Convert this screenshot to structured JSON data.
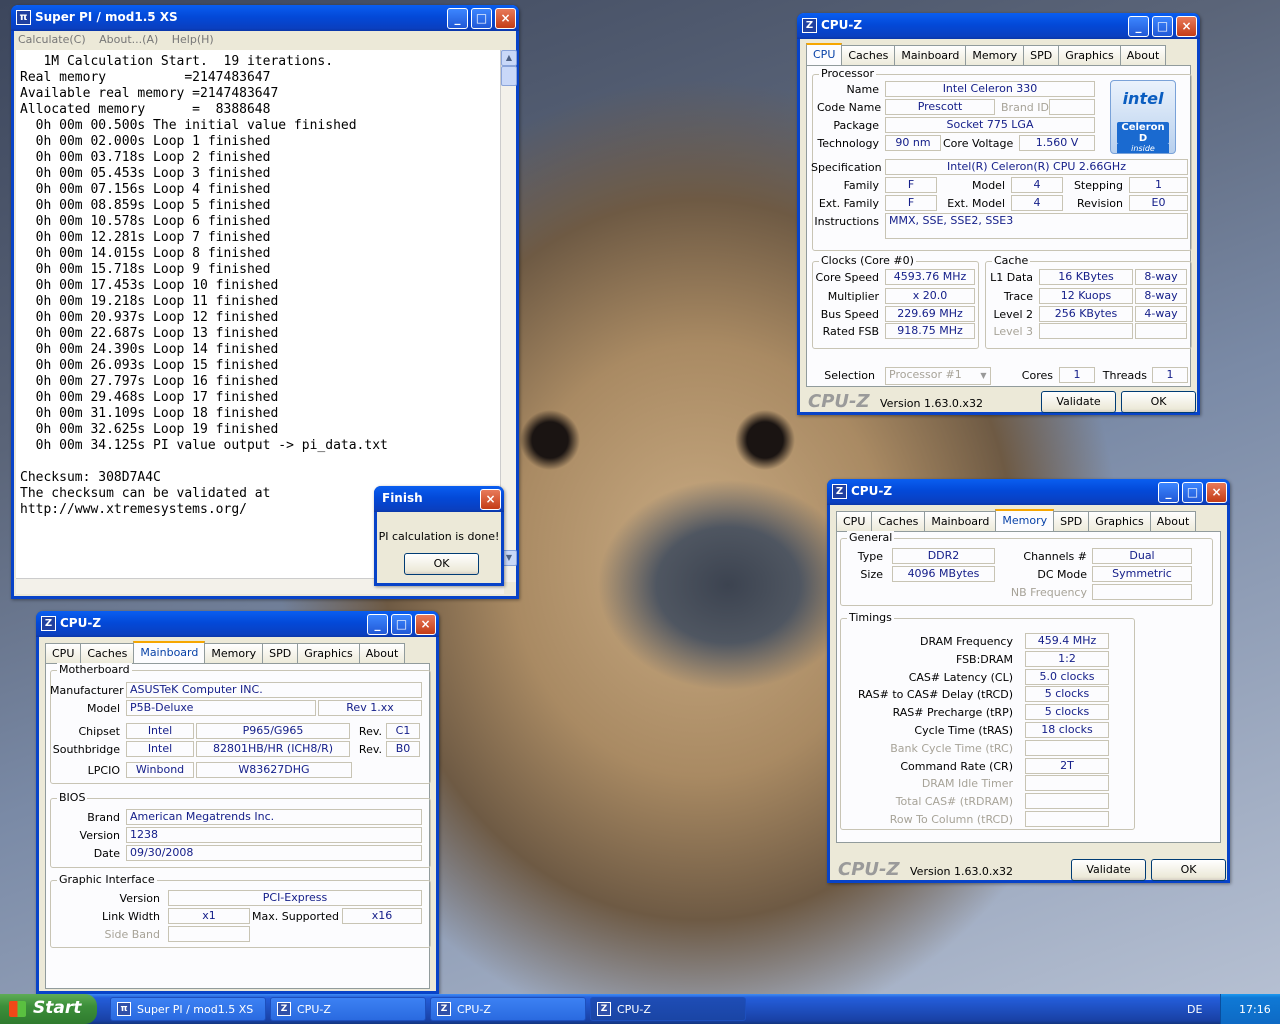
{
  "superpi": {
    "title": "Super PI / mod1.5 XS",
    "menu": [
      "Calculate(C)",
      "About...(A)",
      "Help(H)"
    ],
    "output": "   1M Calculation Start.  19 iterations.\nReal memory          =2147483647\nAvailable real memory =2147483647\nAllocated memory      =  8388648\n  0h 00m 00.500s The initial value finished\n  0h 00m 02.000s Loop 1 finished\n  0h 00m 03.718s Loop 2 finished\n  0h 00m 05.453s Loop 3 finished\n  0h 00m 07.156s Loop 4 finished\n  0h 00m 08.859s Loop 5 finished\n  0h 00m 10.578s Loop 6 finished\n  0h 00m 12.281s Loop 7 finished\n  0h 00m 14.015s Loop 8 finished\n  0h 00m 15.718s Loop 9 finished\n  0h 00m 17.453s Loop 10 finished\n  0h 00m 19.218s Loop 11 finished\n  0h 00m 20.937s Loop 12 finished\n  0h 00m 22.687s Loop 13 finished\n  0h 00m 24.390s Loop 14 finished\n  0h 00m 26.093s Loop 15 finished\n  0h 00m 27.797s Loop 16 finished\n  0h 00m 29.468s Loop 17 finished\n  0h 00m 31.109s Loop 18 finished\n  0h 00m 32.625s Loop 19 finished\n  0h 00m 34.125s PI value output -> pi_data.txt\n\nChecksum: 308D7A4C\nThe checksum can be validated at\nhttp://www.xtremesystems.org/"
  },
  "finish": {
    "title": "Finish",
    "message": "PI calculation is done!",
    "ok": "OK"
  },
  "cpuz_title": "CPU-Z",
  "cpuz_tabs": [
    "CPU",
    "Caches",
    "Mainboard",
    "Memory",
    "SPD",
    "Graphics",
    "About"
  ],
  "cpuz_brand": "CPU-Z",
  "cpuz_version": "Version 1.63.0.x32",
  "validate": "Validate",
  "ok": "OK",
  "cpu": {
    "processor_group": "Processor",
    "name_label": "Name",
    "name": "Intel Celeron 330",
    "codename_label": "Code Name",
    "codename": "Prescott",
    "brandid_label": "Brand ID",
    "brandid": "",
    "package_label": "Package",
    "package": "Socket 775 LGA",
    "technology_label": "Technology",
    "technology": "90 nm",
    "corevoltage_label": "Core Voltage",
    "corevoltage": "1.560 V",
    "spec_label": "Specification",
    "spec": "Intel(R) Celeron(R) CPU 2.66GHz",
    "family_label": "Family",
    "family": "F",
    "model_label": "Model",
    "model": "4",
    "stepping_label": "Stepping",
    "stepping": "1",
    "extfamily_label": "Ext. Family",
    "extfamily": "F",
    "extmodel_label": "Ext. Model",
    "extmodel": "4",
    "revision_label": "Revision",
    "revision": "E0",
    "instructions_label": "Instructions",
    "instructions": "MMX, SSE, SSE2, SSE3",
    "logo_top": "intel",
    "logo_bottom": "Celeron D",
    "logo_inside": "inside",
    "clocks_group": "Clocks (Core #0)",
    "corespeed_label": "Core Speed",
    "corespeed": "4593.76 MHz",
    "multiplier_label": "Multiplier",
    "multiplier": "x 20.0",
    "busspeed_label": "Bus Speed",
    "busspeed": "229.69 MHz",
    "ratedfsb_label": "Rated FSB",
    "ratedfsb": "918.75 MHz",
    "cache_group": "Cache",
    "l1data_label": "L1 Data",
    "l1data": "16 KBytes",
    "l1data_way": "8-way",
    "trace_label": "Trace",
    "trace": "12 Kuops",
    "trace_way": "8-way",
    "level2_label": "Level 2",
    "level2": "256 KBytes",
    "level2_way": "4-way",
    "level3_label": "Level 3",
    "selection_label": "Selection",
    "selection": "Processor #1",
    "cores_label": "Cores",
    "cores": "1",
    "threads_label": "Threads",
    "threads": "1"
  },
  "mainboard": {
    "motherboard_group": "Motherboard",
    "manufacturer_label": "Manufacturer",
    "manufacturer": "ASUSTeK Computer INC.",
    "model_label": "Model",
    "model": "P5B-Deluxe",
    "model_rev": "Rev 1.xx",
    "chipset_label": "Chipset",
    "chipset_vendor": "Intel",
    "chipset": "P965/G965",
    "rev_label": "Rev.",
    "chipset_rev": "C1",
    "southbridge_label": "Southbridge",
    "sb_vendor": "Intel",
    "southbridge": "82801HB/HR (ICH8/R)",
    "sb_rev": "B0",
    "lpcio_label": "LPCIO",
    "lpcio_vendor": "Winbond",
    "lpcio": "W83627DHG",
    "bios_group": "BIOS",
    "brand_label": "Brand",
    "brand": "American Megatrends Inc.",
    "version_label": "Version",
    "version": "1238",
    "date_label": "Date",
    "date": "09/30/2008",
    "graphic_group": "Graphic Interface",
    "gi_version_label": "Version",
    "gi_version": "PCI-Express",
    "linkwidth_label": "Link Width",
    "linkwidth": "x1",
    "maxsupported_label": "Max. Supported",
    "maxsupported": "x16",
    "sideband_label": "Side Band"
  },
  "memory": {
    "general_group": "General",
    "type_label": "Type",
    "type": "DDR2",
    "channels_label": "Channels #",
    "channels": "Dual",
    "size_label": "Size",
    "size": "4096 MBytes",
    "dcmode_label": "DC Mode",
    "dcmode": "Symmetric",
    "nbfreq_label": "NB Frequency",
    "timings_group": "Timings",
    "rows": [
      {
        "label": "DRAM Frequency",
        "value": "459.4 MHz",
        "enabled": true
      },
      {
        "label": "FSB:DRAM",
        "value": "1:2",
        "enabled": true
      },
      {
        "label": "CAS# Latency (CL)",
        "value": "5.0 clocks",
        "enabled": true
      },
      {
        "label": "RAS# to CAS# Delay (tRCD)",
        "value": "5 clocks",
        "enabled": true
      },
      {
        "label": "RAS# Precharge (tRP)",
        "value": "5 clocks",
        "enabled": true
      },
      {
        "label": "Cycle Time (tRAS)",
        "value": "18 clocks",
        "enabled": true
      },
      {
        "label": "Bank Cycle Time (tRC)",
        "value": "",
        "enabled": false
      },
      {
        "label": "Command Rate (CR)",
        "value": "2T",
        "enabled": true
      },
      {
        "label": "DRAM Idle Timer",
        "value": "",
        "enabled": false
      },
      {
        "label": "Total CAS# (tRDRAM)",
        "value": "",
        "enabled": false
      },
      {
        "label": "Row To Column (tRCD)",
        "value": "",
        "enabled": false
      }
    ]
  },
  "taskbar": {
    "start": "Start",
    "tasks": [
      "Super PI / mod1.5 XS",
      "CPU-Z",
      "CPU-Z",
      "CPU-Z"
    ],
    "lang": "DE",
    "clock": "17:16"
  }
}
